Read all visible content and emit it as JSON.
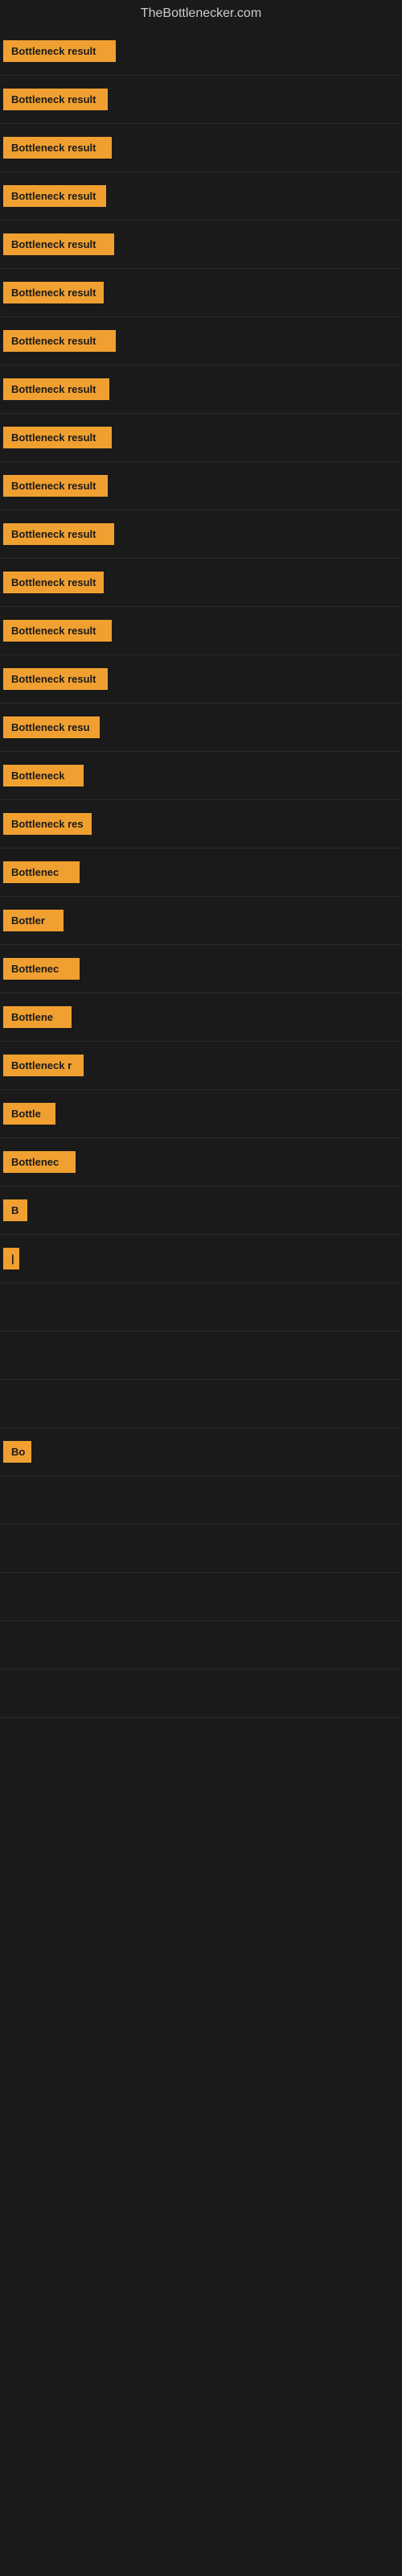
{
  "site": {
    "title": "TheBottlenecker.com"
  },
  "rows": [
    {
      "id": 1,
      "label": "Bottleneck result"
    },
    {
      "id": 2,
      "label": "Bottleneck result"
    },
    {
      "id": 3,
      "label": "Bottleneck result"
    },
    {
      "id": 4,
      "label": "Bottleneck result"
    },
    {
      "id": 5,
      "label": "Bottleneck result"
    },
    {
      "id": 6,
      "label": "Bottleneck result"
    },
    {
      "id": 7,
      "label": "Bottleneck result"
    },
    {
      "id": 8,
      "label": "Bottleneck result"
    },
    {
      "id": 9,
      "label": "Bottleneck result"
    },
    {
      "id": 10,
      "label": "Bottleneck result"
    },
    {
      "id": 11,
      "label": "Bottleneck result"
    },
    {
      "id": 12,
      "label": "Bottleneck result"
    },
    {
      "id": 13,
      "label": "Bottleneck result"
    },
    {
      "id": 14,
      "label": "Bottleneck result"
    },
    {
      "id": 15,
      "label": "Bottleneck resu"
    },
    {
      "id": 16,
      "label": "Bottleneck"
    },
    {
      "id": 17,
      "label": "Bottleneck res"
    },
    {
      "id": 18,
      "label": "Bottlenec"
    },
    {
      "id": 19,
      "label": "Bottler"
    },
    {
      "id": 20,
      "label": "Bottlenec"
    },
    {
      "id": 21,
      "label": "Bottlene"
    },
    {
      "id": 22,
      "label": "Bottleneck r"
    },
    {
      "id": 23,
      "label": "Bottle"
    },
    {
      "id": 24,
      "label": "Bottlenec"
    },
    {
      "id": 25,
      "label": "B"
    },
    {
      "id": 26,
      "label": "|"
    },
    {
      "id": 27,
      "label": ""
    },
    {
      "id": 28,
      "label": ""
    },
    {
      "id": 29,
      "label": ""
    },
    {
      "id": 30,
      "label": "Bo"
    },
    {
      "id": 31,
      "label": ""
    },
    {
      "id": 32,
      "label": ""
    },
    {
      "id": 33,
      "label": ""
    },
    {
      "id": 34,
      "label": ""
    },
    {
      "id": 35,
      "label": ""
    }
  ],
  "colors": {
    "badge_bg": "#f0a030",
    "bg": "#1a1a1a",
    "title": "#cccccc"
  }
}
